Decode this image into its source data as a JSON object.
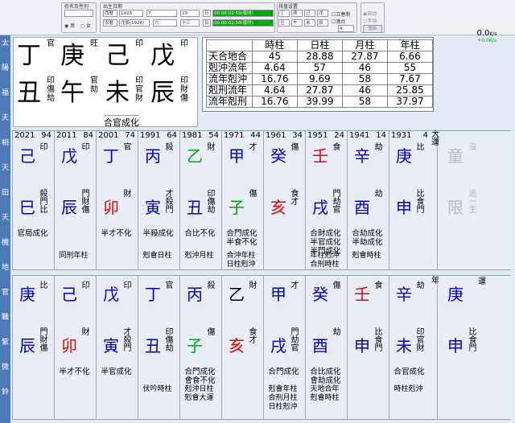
{
  "toolbar": {
    "name_label": "姓名及性别",
    "birth_label": "出生日期",
    "tz_label": "时区",
    "settle_label": "排盘设置",
    "male": "男",
    "female": "女",
    "calendar": "西暦",
    "year": "1928",
    "month": "7",
    "day": "29",
    "hour": "日",
    "time": "00:00:02:59(夜时)",
    "calendar2": "农暦",
    "lunar_year": "戊辰(1928)",
    "lunar_month": "六",
    "lunar_day": "十三",
    "lunar_day2": "日",
    "time2": "00:00:02:59(夜时)",
    "cb1": "丁",
    "cb2": "丑",
    "cb3": "庚",
    "cb4": "午",
    "cb5": "己",
    "cb6": "未",
    "cb7": "戊",
    "cb8": "辰",
    "lichun": "立春制",
    "jieqi": "节气",
    "trade": "港台",
    "count": "4",
    "auto": "自动",
    "manual": "手动",
    "save": "重新"
  },
  "sidebar": [
    "太",
    "陽",
    "福",
    "天",
    "相",
    "天",
    "田",
    "天",
    "機",
    "地",
    "官",
    "職",
    "紫",
    "微",
    "鈴"
  ],
  "zoom": {
    "value": "0.0",
    "unit": "K/s",
    "sub": "+0.0K/s"
  },
  "natal": {
    "stems": [
      {
        "c": "丁",
        "t": "官"
      },
      {
        "c": "庚",
        "t": "旺"
      },
      {
        "c": "己",
        "t": "印"
      },
      {
        "c": "戊",
        "t": "印"
      }
    ],
    "branches": [
      {
        "c": "丑",
        "t": "印傷劫"
      },
      {
        "c": "午",
        "t": "官劫"
      },
      {
        "c": "未",
        "t": "印官財"
      },
      {
        "c": "辰",
        "t": "印財傷"
      }
    ],
    "note": "合官成化"
  },
  "strength": {
    "headers": [
      "",
      "時柱",
      "日柱",
      "月柱",
      "年柱"
    ],
    "rows": [
      [
        "天合地合",
        "45",
        "28.88",
        "27.87",
        "6.66"
      ],
      [
        "剋沖流年",
        "4.64",
        "57",
        "46",
        "55"
      ],
      [
        "流年剋沖",
        "16.76",
        "9.69",
        "58",
        "7.67"
      ],
      [
        "剋刑流年",
        "4.64",
        "27.87",
        "46",
        "25.85"
      ],
      [
        "流年剋刑",
        "16.76",
        "39.99",
        "58",
        "37.97"
      ]
    ]
  },
  "dayun": {
    "label": "大運",
    "cols": [
      {
        "year": "2021",
        "age": "94",
        "gan": "己",
        "gt": "印",
        "gc": "blue",
        "zhi": "巳",
        "zt": "殺門比",
        "zc": "blue",
        "notes": [
          "官局成化"
        ]
      },
      {
        "year": "2011",
        "age": "84",
        "gan": "戊",
        "gt": "印",
        "gc": "blue",
        "zhi": "辰",
        "zt": "門財傷",
        "zc": "blue",
        "notes": []
      },
      {
        "year": "2001",
        "age": "74",
        "gan": "丁",
        "gt": "官",
        "gc": "blue",
        "zhi": "卯",
        "zt": "財",
        "zc": "red",
        "notes": [
          "半才不化"
        ]
      },
      {
        "year": "1991",
        "age": "64",
        "gan": "丙",
        "gt": "殺",
        "gc": "blue",
        "zhi": "寅",
        "zt": "才殺門",
        "zc": "blue",
        "notes": [
          "半殺成化"
        ]
      },
      {
        "year": "1981",
        "age": "54",
        "gan": "乙",
        "gt": "財",
        "gc": "green",
        "zhi": "丑",
        "zt": "印傷劫",
        "zc": "blue",
        "notes": [
          "合比不化"
        ]
      },
      {
        "year": "1971",
        "age": "44",
        "gan": "甲",
        "gt": "才",
        "gc": "blue",
        "zhi": "子",
        "zt": "傷",
        "zc": "green",
        "notes": [
          "合門成化",
          "半食不化"
        ]
      },
      {
        "year": "1961",
        "age": "34",
        "gan": "癸",
        "gt": "傷",
        "gc": "blue",
        "zhi": "亥",
        "zt": "食才",
        "zc": "red",
        "notes": []
      },
      {
        "year": "1951",
        "age": "24",
        "gan": "壬",
        "gt": "食",
        "gc": "red",
        "zhi": "戌",
        "zt": "門劫官",
        "zc": "blue",
        "notes": [
          "合財成化",
          "半官成化",
          "半門成化"
        ]
      },
      {
        "year": "1941",
        "age": "14",
        "gan": "辛",
        "gt": "劫",
        "gc": "blue",
        "zhi": "酉",
        "zt": "劫",
        "zc": "blue",
        "notes": [
          "合劫成化",
          "半劫成化"
        ]
      },
      {
        "year": "1931",
        "age": "4",
        "gan": "庚",
        "gt": "比",
        "gc": "blue",
        "zhi": "申",
        "zt": "比食門",
        "zc": "blue",
        "notes": []
      }
    ],
    "below": [
      [
        "同刑年柱"
      ],
      [
        "剋會日柱"
      ],
      [
        "剋沖月柱"
      ],
      [
        "合沖年柱",
        "日柱剋沖"
      ],
      [
        "年柱剋沖",
        "合刑時柱"
      ],
      [
        "剋會時柱"
      ]
    ],
    "extra": {
      "gan": "童",
      "zhi": "限",
      "gt": "沒",
      "zt": "過一生"
    }
  },
  "liunian": {
    "label": "年",
    "label2": "運",
    "cols": [
      {
        "gan": "庚",
        "gt": "比",
        "gc": "blue",
        "zhi": "辰",
        "zt": "門財傷",
        "zc": "blue",
        "notes": []
      },
      {
        "gan": "己",
        "gt": "印",
        "gc": "blue",
        "zhi": "卯",
        "zt": "財",
        "zc": "red",
        "notes": [
          "半才不化"
        ]
      },
      {
        "gan": "戊",
        "gt": "印",
        "gc": "blue",
        "zhi": "寅",
        "zt": "才殺門",
        "zc": "blue",
        "notes": [
          "半官成化"
        ]
      },
      {
        "gan": "丁",
        "gt": "官",
        "gc": "blue",
        "zhi": "丑",
        "zt": "印傷劫",
        "zc": "blue",
        "notes": []
      },
      {
        "gan": "丙",
        "gt": "殺",
        "gc": "blue",
        "zhi": "子",
        "zt": "傷",
        "zc": "green",
        "notes": [
          "合門成化",
          "會食不化"
        ]
      },
      {
        "gan": "乙",
        "gt": "財",
        "gc": "dk",
        "zhi": "亥",
        "zt": "食才",
        "zc": "red",
        "notes": []
      },
      {
        "gan": "甲",
        "gt": "才",
        "gc": "blue",
        "zhi": "戌",
        "zt": "門劫官",
        "zc": "blue",
        "notes": [
          "合門成化"
        ]
      },
      {
        "gan": "癸",
        "gt": "傷",
        "gc": "blue",
        "zhi": "酉",
        "zt": "劫",
        "zc": "blue",
        "notes": [
          "合比成化",
          "會劫成化"
        ]
      },
      {
        "gan": "壬",
        "gt": "食",
        "gc": "red",
        "zhi": "申",
        "zt": "比食門",
        "zc": "blue",
        "notes": []
      },
      {
        "gan": "辛",
        "gt": "劫",
        "gc": "blue",
        "zhi": "未",
        "zt": "印官財",
        "zc": "blue",
        "notes": [
          "合官成化"
        ]
      }
    ],
    "below": [
      [
        "伏吟時柱"
      ],
      [
        "剋沖日柱",
        "剋會大運"
      ],
      [
        "剋會年柱",
        "合刑月柱",
        "日柱剋沖"
      ],
      [
        "天地合年",
        "剋會時柱"
      ],
      [
        "時柱剋沖"
      ]
    ],
    "extra": {
      "gan": "庚",
      "zhi": "申",
      "gt": "",
      "zt": "比食門"
    }
  }
}
